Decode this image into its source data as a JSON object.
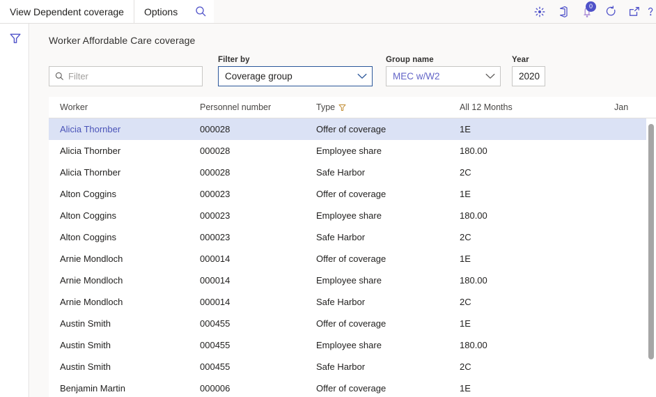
{
  "topbar": {
    "tabs": [
      {
        "label": "View Dependent coverage",
        "name": "tab-view-dependent-coverage"
      },
      {
        "label": "Options",
        "name": "tab-options"
      }
    ],
    "search_icon": "search-icon",
    "right_icons": [
      {
        "name": "settings-gear-icon",
        "glyph": "gear"
      },
      {
        "name": "office-app-launcher-icon",
        "glyph": "office"
      },
      {
        "name": "notifications-icon",
        "glyph": "bell",
        "badge": "0"
      },
      {
        "name": "refresh-icon",
        "glyph": "refresh"
      },
      {
        "name": "open-in-new-window-icon",
        "glyph": "popout"
      },
      {
        "name": "help-icon",
        "glyph": "help"
      }
    ]
  },
  "leftrail": {
    "filter_pane_icon": "filter-icon"
  },
  "main": {
    "title": "Worker Affordable Care coverage",
    "quick_filter": {
      "placeholder": "Filter",
      "value": "",
      "icon": "search-icon"
    },
    "filter_by": {
      "label": "Filter by",
      "value": "Coverage group"
    },
    "group_name": {
      "label": "Group name",
      "value": "MEC w/W2"
    },
    "year": {
      "label": "Year",
      "value": "2020"
    }
  },
  "grid": {
    "columns": [
      {
        "label": "Worker",
        "name": "column-header-worker",
        "filtered": false
      },
      {
        "label": "Personnel number",
        "name": "column-header-personnel-number",
        "filtered": false
      },
      {
        "label": "Type",
        "name": "column-header-type",
        "filtered": true
      },
      {
        "label": "All 12 Months",
        "name": "column-header-all-12-months",
        "filtered": false
      },
      {
        "label": "Jan",
        "name": "column-header-jan",
        "filtered": false
      }
    ],
    "rows": [
      {
        "worker": "Alicia Thornber",
        "personnel": "000028",
        "type": "Offer of coverage",
        "all12": "1E",
        "jan": "",
        "selected": true
      },
      {
        "worker": "Alicia Thornber",
        "personnel": "000028",
        "type": "Employee share",
        "all12": "180.00",
        "jan": "",
        "selected": false
      },
      {
        "worker": "Alicia Thornber",
        "personnel": "000028",
        "type": "Safe Harbor",
        "all12": "2C",
        "jan": "",
        "selected": false
      },
      {
        "worker": "Alton Coggins",
        "personnel": "000023",
        "type": "Offer of coverage",
        "all12": "1E",
        "jan": "",
        "selected": false
      },
      {
        "worker": "Alton Coggins",
        "personnel": "000023",
        "type": "Employee share",
        "all12": "180.00",
        "jan": "",
        "selected": false
      },
      {
        "worker": "Alton Coggins",
        "personnel": "000023",
        "type": "Safe Harbor",
        "all12": "2C",
        "jan": "",
        "selected": false
      },
      {
        "worker": "Arnie Mondloch",
        "personnel": "000014",
        "type": "Offer of coverage",
        "all12": "1E",
        "jan": "",
        "selected": false
      },
      {
        "worker": "Arnie Mondloch",
        "personnel": "000014",
        "type": "Employee share",
        "all12": "180.00",
        "jan": "",
        "selected": false
      },
      {
        "worker": "Arnie Mondloch",
        "personnel": "000014",
        "type": "Safe Harbor",
        "all12": "2C",
        "jan": "",
        "selected": false
      },
      {
        "worker": "Austin Smith",
        "personnel": "000455",
        "type": "Offer of coverage",
        "all12": "1E",
        "jan": "",
        "selected": false
      },
      {
        "worker": "Austin Smith",
        "personnel": "000455",
        "type": "Employee share",
        "all12": "180.00",
        "jan": "",
        "selected": false
      },
      {
        "worker": "Austin Smith",
        "personnel": "000455",
        "type": "Safe Harbor",
        "all12": "2C",
        "jan": "",
        "selected": false
      },
      {
        "worker": "Benjamin Martin",
        "personnel": "000006",
        "type": "Offer of coverage",
        "all12": "1E",
        "jan": "",
        "selected": false
      }
    ],
    "scrollbar": {
      "name": "vertical-scrollbar"
    }
  },
  "colors": {
    "accent": "#4f52c9",
    "selected_row_bg": "#dbe2f5",
    "selected_row_text": "#4a53b8",
    "link": "#6264c7",
    "filter_icon_gold": "#c08a2e",
    "chrome_bg": "#faf9f8",
    "border": "#e1dfdd"
  }
}
